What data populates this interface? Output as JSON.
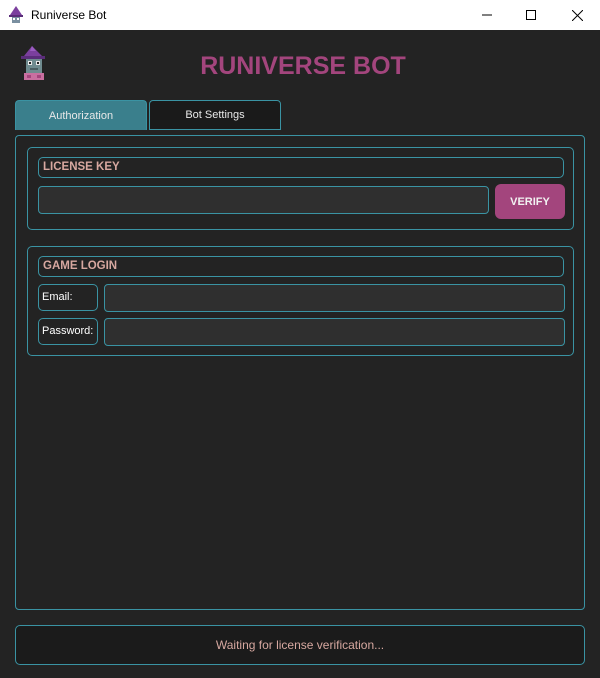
{
  "window": {
    "title": "Runiverse Bot",
    "app_icon": "wizard-icon"
  },
  "header": {
    "logo_icon": "wizard-frog-icon",
    "heading": "RUNIVERSE BOT"
  },
  "tabs": [
    {
      "label": "Authorization",
      "active": true
    },
    {
      "label": "Bot Settings",
      "active": false
    }
  ],
  "license": {
    "title": "LICENSE KEY",
    "key_value": "",
    "verify_label": "VERIFY"
  },
  "game_login": {
    "title": "GAME LOGIN",
    "email_label": "Email:",
    "email_value": "",
    "password_label": "Password:",
    "password_value": ""
  },
  "status": {
    "text": "Waiting for license verification..."
  },
  "colors": {
    "accent": "#3a93a3",
    "brand": "#a3457d",
    "background": "#232323"
  }
}
